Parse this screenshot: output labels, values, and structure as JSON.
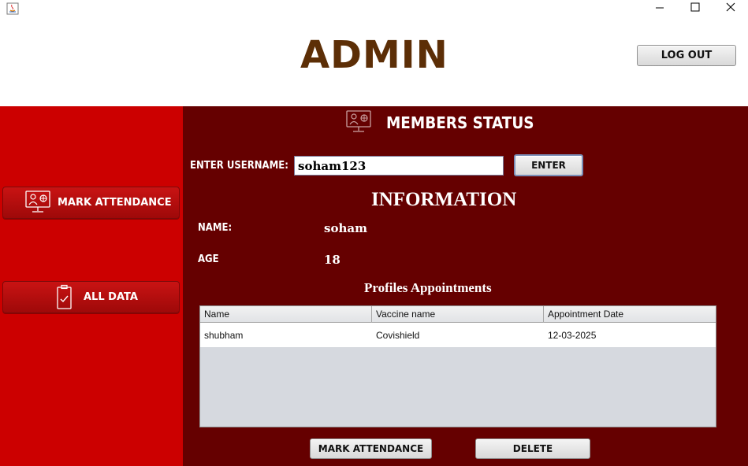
{
  "window": {
    "app_icon": "java-icon",
    "controls": [
      "minimize-icon",
      "maximize-icon",
      "close-icon"
    ]
  },
  "header": {
    "title": "ADMIN",
    "logout_label": "LOG OUT"
  },
  "sidebar": {
    "items": [
      {
        "label": "MARK ATTENDANCE",
        "icon": "monitor-people-icon"
      },
      {
        "label": "ALL DATA",
        "icon": "clipboard-check-icon"
      }
    ]
  },
  "main": {
    "title": "MEMBERS STATUS",
    "title_icon": "monitor-people-icon",
    "username_label": "ENTER USERNAME:",
    "username_value": "soham123",
    "enter_label": "ENTER",
    "info_title": "INFORMATION",
    "name_label": "NAME:",
    "name_value": "soham",
    "age_label": "AGE",
    "age_value": "18",
    "profiles_title": "Profiles Appointments",
    "table": {
      "columns": [
        "Name",
        "Vaccine name",
        "Appointment Date"
      ],
      "rows": [
        [
          "shubham",
          "Covishield",
          "12-03-2025"
        ]
      ]
    },
    "mark_attendance_label": "MARK ATTENDANCE",
    "delete_label": "DELETE"
  },
  "colors": {
    "sidebar_bg": "#cc0000",
    "main_bg": "#650000",
    "title_brown": "#5c2e06"
  }
}
